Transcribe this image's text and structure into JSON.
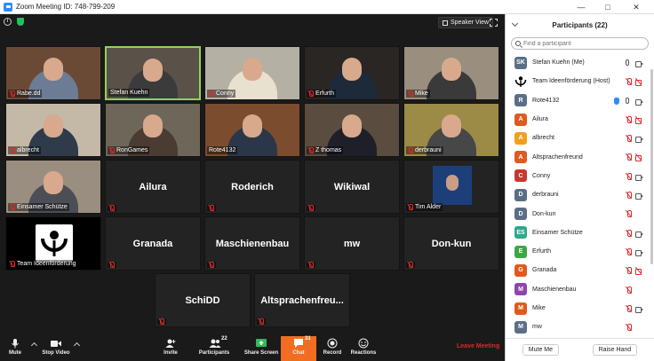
{
  "window": {
    "title": "Zoom Meeting ID: 748-799-209"
  },
  "meeting": {
    "speaker_view_label": "Speaker View",
    "tiles": [
      {
        "label": "Rabe.dd",
        "video": true,
        "bg": "#6b4a35",
        "shirt": "#6d7c95",
        "active": false,
        "muted": true
      },
      {
        "label": "Stefan Kuehn",
        "video": true,
        "bg": "#5a5148",
        "shirt": "#3b3b3b",
        "active": true,
        "muted": false
      },
      {
        "label": "Conny",
        "video": true,
        "bg": "#b5b0a4",
        "shirt": "#e8e1cf",
        "active": false,
        "muted": true
      },
      {
        "label": "Erfurth",
        "video": true,
        "bg": "#2a2623",
        "shirt": "#1d2a3a",
        "active": false,
        "muted": true
      },
      {
        "label": "Mike",
        "video": true,
        "bg": "#9a8e7e",
        "shirt": "#3a3a3a",
        "active": false,
        "muted": true
      },
      {
        "label": "albrecht",
        "video": true,
        "bg": "#c4b9a7",
        "shirt": "#2f3b4a",
        "active": false,
        "muted": true
      },
      {
        "label": "RonGames",
        "video": true,
        "bg": "#6e6658",
        "shirt": "#4a3c33",
        "active": false,
        "muted": true
      },
      {
        "label": "Rote4132",
        "video": true,
        "bg": "#7b4d2e",
        "shirt": "#2b3748",
        "active": false,
        "muted": false
      },
      {
        "label": "Z thomas",
        "video": true,
        "bg": "#5a4c3f",
        "shirt": "#1f1f2a",
        "active": false,
        "muted": true
      },
      {
        "label": "derbrauni",
        "video": true,
        "bg": "#9b8b47",
        "shirt": "#474747",
        "active": false,
        "muted": true
      },
      {
        "label": "Einsamer Schütze",
        "video": true,
        "bg": "#9a8e80",
        "shirt": "#4c4e55",
        "active": false,
        "muted": true
      },
      {
        "label": "Ailura",
        "video": false,
        "muted": true
      },
      {
        "label": "Roderich",
        "video": false,
        "muted": true
      },
      {
        "label": "Wikiwal",
        "video": false,
        "muted": true
      },
      {
        "label": "Tim Alder",
        "video": "photo",
        "muted": true
      },
      {
        "label": "Team Ideenförderung",
        "video": "logo",
        "muted": true
      },
      {
        "label": "Granada",
        "video": false,
        "muted": true
      },
      {
        "label": "Maschienenbau",
        "video": false,
        "muted": true
      },
      {
        "label": "mw",
        "video": false,
        "muted": true
      },
      {
        "label": "Don-kun",
        "video": false,
        "muted": true
      },
      {
        "label": "SchiDD",
        "video": false,
        "muted": true
      },
      {
        "label": "Altsprachenfreu...",
        "video": false,
        "muted": true
      }
    ]
  },
  "toolbar": {
    "mute": "Mute",
    "stop_video": "Stop Video",
    "invite": "Invite",
    "participants": "Participants",
    "participants_count": "22",
    "share_screen": "Share Screen",
    "chat": "Chat",
    "chat_count": "31",
    "record": "Record",
    "reactions": "Reactions",
    "leave": "Leave Meeting"
  },
  "panel": {
    "title": "Participants (22)",
    "search_placeholder": "Find a participant",
    "mute_me": "Mute Me",
    "raise_hand": "Raise Hand",
    "participants": [
      {
        "initials": "SK",
        "name": "Stefan Kuehn (Me)",
        "color": "#5a6f86",
        "mic": "on",
        "cam": "on",
        "hand": false
      },
      {
        "initials": "",
        "name": "Team Ideenförderung (Host)",
        "color": "#ffffff",
        "mic": "off",
        "cam": "off",
        "hand": false,
        "logo": true
      },
      {
        "initials": "R",
        "name": "Rote4132",
        "color": "#5a6f86",
        "mic": "on",
        "cam": "on",
        "hand": true
      },
      {
        "initials": "A",
        "name": "Ailura",
        "color": "#e05a1e",
        "mic": "off",
        "cam": "off",
        "hand": false
      },
      {
        "initials": "A",
        "name": "albrecht",
        "color": "#f0a020",
        "mic": "off",
        "cam": "on",
        "hand": false
      },
      {
        "initials": "A",
        "name": "Altsprachenfreund",
        "color": "#e05a1e",
        "mic": "off",
        "cam": "off",
        "hand": false
      },
      {
        "initials": "C",
        "name": "Conny",
        "color": "#c8372d",
        "mic": "off",
        "cam": "on",
        "hand": false
      },
      {
        "initials": "D",
        "name": "derbrauni",
        "color": "#5a6f86",
        "mic": "off",
        "cam": "on",
        "hand": false
      },
      {
        "initials": "D",
        "name": "Don-kun",
        "color": "#5a6f86",
        "mic": "off",
        "cam": "none",
        "hand": false
      },
      {
        "initials": "ES",
        "name": "Einsamer Schütze",
        "color": "#2ea88a",
        "mic": "off",
        "cam": "on",
        "hand": false
      },
      {
        "initials": "E",
        "name": "Erfurth",
        "color": "#3aa845",
        "mic": "off",
        "cam": "on",
        "hand": false
      },
      {
        "initials": "G",
        "name": "Granada",
        "color": "#e05a1e",
        "mic": "off",
        "cam": "off",
        "hand": false
      },
      {
        "initials": "M",
        "name": "Maschienenbau",
        "color": "#8e44ad",
        "mic": "off",
        "cam": "none",
        "hand": false
      },
      {
        "initials": "M",
        "name": "Mike",
        "color": "#e05a1e",
        "mic": "off",
        "cam": "on",
        "hand": false
      },
      {
        "initials": "M",
        "name": "mw",
        "color": "#5a6f86",
        "mic": "off",
        "cam": "none",
        "hand": false
      }
    ]
  }
}
